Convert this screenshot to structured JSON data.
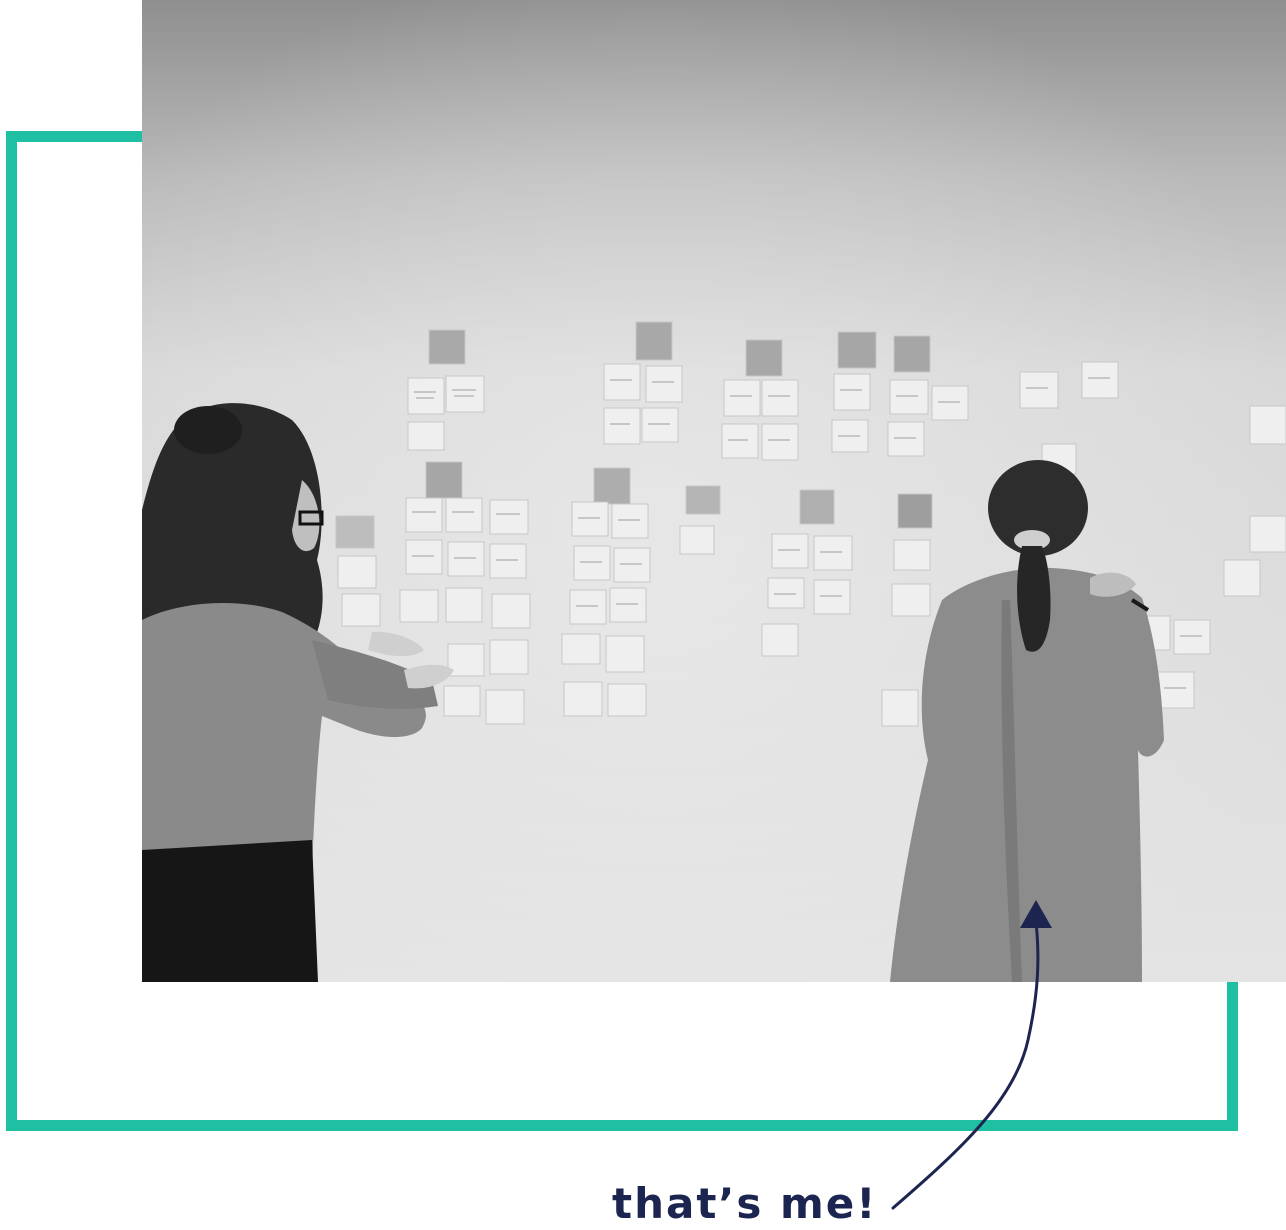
{
  "annotation": {
    "caption": "that’s me!"
  },
  "colors": {
    "frame": "#1fbfa4",
    "caption": "#1c2550",
    "arrow": "#1c2550"
  },
  "photo": {
    "style": "black-and-white",
    "subject": "two-people-placing-sticky-notes-on-wall"
  }
}
